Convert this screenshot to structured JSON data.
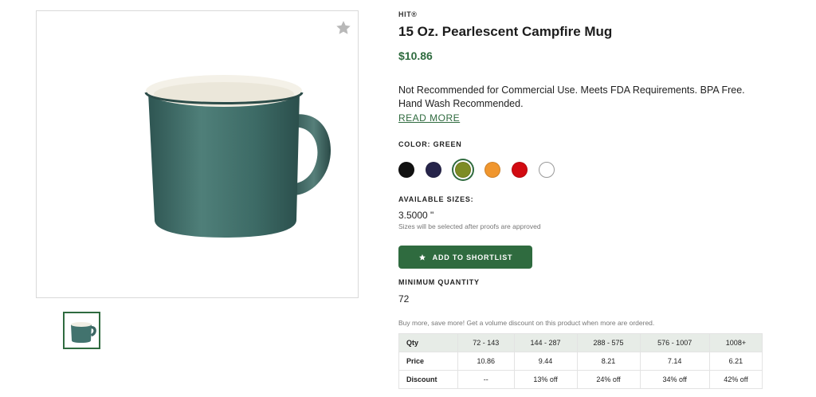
{
  "product": {
    "brand": "HIT®",
    "title": "15 Oz. Pearlescent Campfire Mug",
    "price": "$10.86",
    "description": "Not Recommended for Commercial Use. Meets FDA Requirements. BPA Free. Hand Wash Recommended.",
    "read_more": "READ MORE"
  },
  "colors": {
    "label": "COLOR: GREEN",
    "swatches": [
      {
        "name": "black",
        "hex": "#111111"
      },
      {
        "name": "navy",
        "hex": "#26244a"
      },
      {
        "name": "green",
        "hex": "#7d8c25",
        "selected": true
      },
      {
        "name": "orange",
        "hex": "#f0962e"
      },
      {
        "name": "red",
        "hex": "#d20a11"
      },
      {
        "name": "white",
        "hex": "#ffffff"
      }
    ]
  },
  "sizes": {
    "label": "AVAILABLE SIZES:",
    "value": "3.5000 \"",
    "note": "Sizes will be selected after proofs are approved"
  },
  "shortlist": {
    "label": "ADD TO SHORTLIST"
  },
  "min_quantity": {
    "label": "MINIMUM QUANTITY",
    "value": "72"
  },
  "volume": {
    "note": "Buy more, save more! Get a volume discount on this product when more are ordered.",
    "header": [
      "Qty",
      "72 - 143",
      "144 - 287",
      "288 - 575",
      "576 - 1007",
      "1008+"
    ],
    "price_row": [
      "Price",
      "10.86",
      "9.44",
      "8.21",
      "7.14",
      "6.21"
    ],
    "discount_row": [
      "Discount",
      "--",
      "13% off",
      "24% off",
      "34% off",
      "42% off"
    ]
  },
  "theme": {
    "accent": "#2f6b3f",
    "mug_body": "#3f6f6a"
  }
}
